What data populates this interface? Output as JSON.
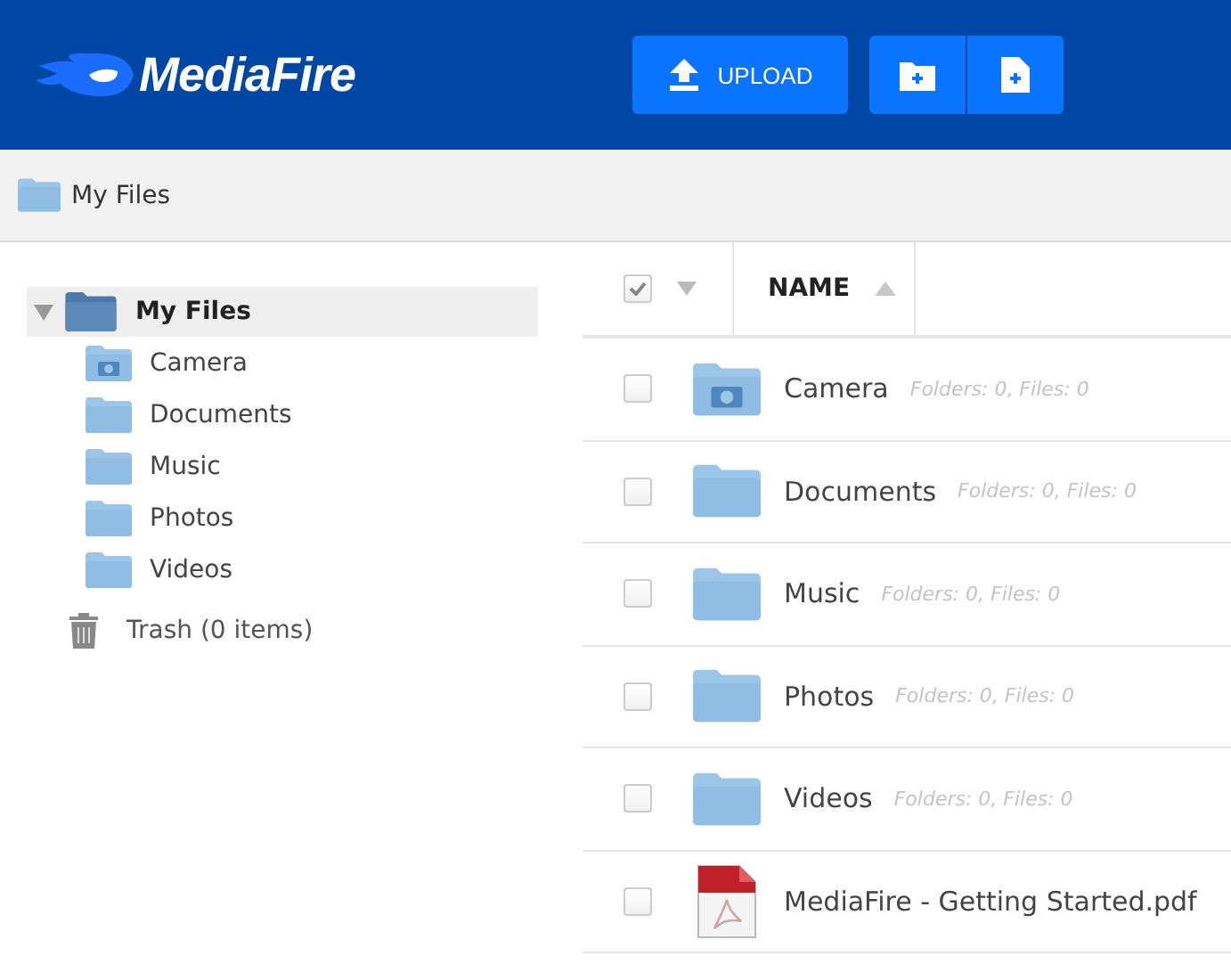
{
  "header": {
    "logo": "MediaFire",
    "upload_button": "UPLOAD"
  },
  "breadcrumb": {
    "label": "My Files"
  },
  "tree": {
    "label": "My Files",
    "expanded": true,
    "selected": true,
    "children": [
      {
        "label": "Camera",
        "kind": "camera"
      },
      {
        "label": "Documents",
        "kind": "folder"
      },
      {
        "label": "Music",
        "kind": "folder"
      },
      {
        "label": "Photos",
        "kind": "folder"
      },
      {
        "label": "Videos",
        "kind": "folder"
      }
    ]
  },
  "trash": {
    "label": "Trash (0 items)"
  },
  "table": {
    "select_all": {
      "checked": true
    },
    "column": "NAME",
    "sorted_ascending": true,
    "rows": [
      {
        "kind": "camera",
        "name": "Camera",
        "meta": "Folders: 0, Files: 0",
        "checked": false
      },
      {
        "kind": "folder",
        "name": "Documents",
        "meta": "Folders: 0, Files: 0",
        "checked": false
      },
      {
        "kind": "folder",
        "name": "Music",
        "meta": "Folders: 0, Files: 0",
        "checked": false
      },
      {
        "kind": "folder",
        "name": "Photos",
        "meta": "Folders: 0, Files: 0",
        "checked": false
      },
      {
        "kind": "folder",
        "name": "Videos",
        "meta": "Folders: 0, Files: 0",
        "checked": false
      },
      {
        "kind": "pdf",
        "name": "MediaFire - Getting Started.pdf",
        "checked": false
      }
    ]
  }
}
